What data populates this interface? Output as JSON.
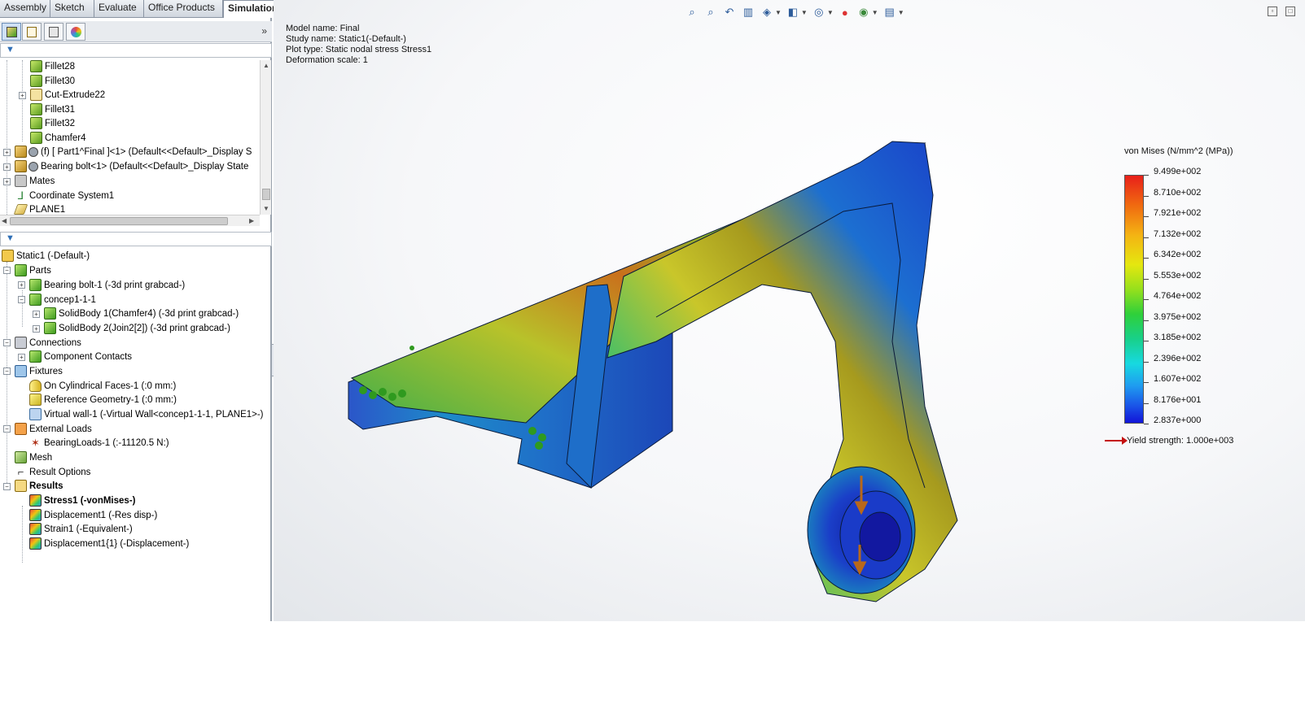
{
  "tabs": [
    "Assembly",
    "Sketch",
    "Evaluate",
    "Office Products",
    "Simulation"
  ],
  "active_tab": "Simulation",
  "feature_tree": {
    "items": [
      {
        "label": "Fillet28",
        "icon": "fillet-icon"
      },
      {
        "label": "Fillet30",
        "icon": "fillet-icon"
      },
      {
        "label": "Cut-Extrude22",
        "icon": "cut-extrude-icon"
      },
      {
        "label": "Fillet31",
        "icon": "fillet-icon"
      },
      {
        "label": "Fillet32",
        "icon": "fillet-icon"
      },
      {
        "label": "Chamfer4",
        "icon": "chamfer-icon"
      },
      {
        "label": "(f) [ Part1^Final ]<1> (Default<<Default>_Display S",
        "icon": "part-icon"
      },
      {
        "label": "Bearing bolt<1> (Default<<Default>_Display State",
        "icon": "part-icon"
      },
      {
        "label": "Mates",
        "icon": "mates-icon"
      },
      {
        "label": "Coordinate System1",
        "icon": "coordinate-system-icon"
      },
      {
        "label": "PLANE1",
        "icon": "plane-icon"
      }
    ]
  },
  "study_tree": {
    "items": [
      {
        "label": "Static1 (-Default-)",
        "icon": "static-study-icon"
      },
      {
        "label": "Parts",
        "icon": "parts-icon"
      },
      {
        "label": "Bearing bolt-1 (-3d print grabcad-)",
        "icon": "part-body-icon"
      },
      {
        "label": "concep1-1-1",
        "icon": "part-body-icon"
      },
      {
        "label": "SolidBody 1(Chamfer4) (-3d print grabcad-)",
        "icon": "solid-body-icon"
      },
      {
        "label": "SolidBody 2(Join2[2]) (-3d print grabcad-)",
        "icon": "solid-body-icon"
      },
      {
        "label": "Connections",
        "icon": "connections-icon"
      },
      {
        "label": "Component Contacts",
        "icon": "component-contacts-icon"
      },
      {
        "label": "Fixtures",
        "icon": "fixtures-icon"
      },
      {
        "label": "On Cylindrical Faces-1 (:0 mm:)",
        "icon": "cylindrical-fixture-icon"
      },
      {
        "label": "Reference Geometry-1 (:0 mm:)",
        "icon": "reference-geometry-icon"
      },
      {
        "label": "Virtual wall-1 (-Virtual Wall<concep1-1-1, PLANE1>-)",
        "icon": "virtual-wall-icon"
      },
      {
        "label": "External Loads",
        "icon": "external-loads-icon"
      },
      {
        "label": "BearingLoads-1 (:-11120.5 N:)",
        "icon": "bearing-load-icon"
      },
      {
        "label": "Mesh",
        "icon": "mesh-icon"
      },
      {
        "label": "Result Options",
        "icon": "result-options-icon"
      },
      {
        "label": "Results",
        "icon": "results-folder-icon"
      },
      {
        "label": "Stress1 (-vonMises-)",
        "icon": "stress-plot-icon"
      },
      {
        "label": "Displacement1 (-Res disp-)",
        "icon": "displacement-plot-icon"
      },
      {
        "label": "Strain1 (-Equivalent-)",
        "icon": "strain-plot-icon"
      },
      {
        "label": "Displacement1{1} (-Displacement-)",
        "icon": "displacement-plot-icon"
      }
    ]
  },
  "model_info": {
    "model_name": "Model name: Final",
    "study_name": "Study name: Static1(-Default-)",
    "plot_type": "Plot type: Static nodal stress Stress1",
    "deformation_scale": "Deformation scale: 1"
  },
  "legend": {
    "title": "von Mises (N/mm^2 (MPa))",
    "values": [
      "9.499e+002",
      "8.710e+002",
      "7.921e+002",
      "7.132e+002",
      "6.342e+002",
      "5.553e+002",
      "4.764e+002",
      "3.975e+002",
      "3.185e+002",
      "2.396e+002",
      "1.607e+002",
      "8.176e+001",
      "2.837e+000"
    ],
    "yield_strength": "Yield strength: 1.000e+003",
    "colors": {
      "max": "#e8201a",
      "mid": "#2fd03a",
      "min": "#1214d8"
    }
  }
}
